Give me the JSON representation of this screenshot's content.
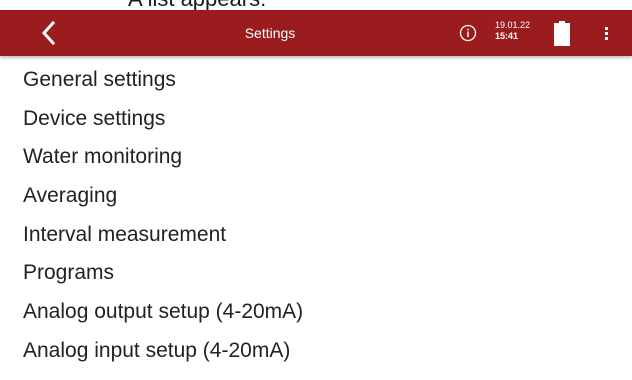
{
  "caption": "A list appears:",
  "header": {
    "title": "Settings",
    "date": "19.01.22",
    "time": "15:41",
    "background": "#9b1c1f",
    "icons": {
      "back": "chevron-left-icon",
      "info": "info-icon",
      "battery": "battery-icon",
      "menu": "more-vertical-icon"
    },
    "battery_level": 1.0
  },
  "settings_list": [
    {
      "label": "General settings"
    },
    {
      "label": "Device settings"
    },
    {
      "label": "Water monitoring"
    },
    {
      "label": "Averaging"
    },
    {
      "label": "Interval measurement"
    },
    {
      "label": "Programs"
    },
    {
      "label": "Analog output setup (4-20mA)"
    },
    {
      "label": "Analog input setup (4-20mA)"
    }
  ]
}
